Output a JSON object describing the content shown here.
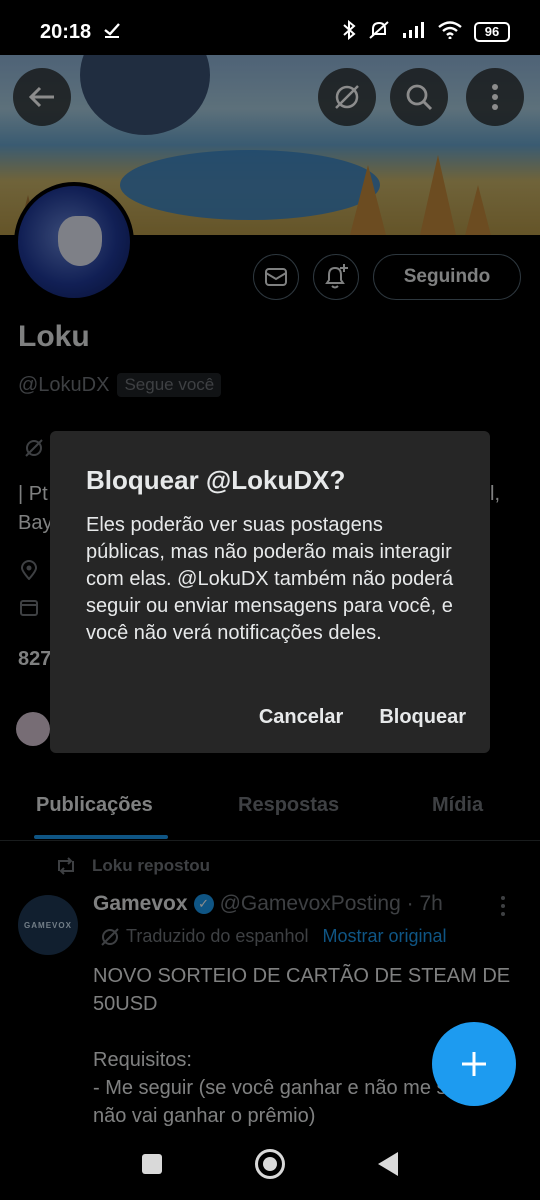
{
  "status_bar": {
    "time": "20:18",
    "battery": "96",
    "icons": [
      "check-icon",
      "bluetooth-icon",
      "mute-icon",
      "signal-icon",
      "wifi-icon",
      "battery-icon"
    ]
  },
  "profile": {
    "name": "Loku",
    "handle": "@LokuDX",
    "follows_you_badge": "Segue você",
    "following_button": "Seguindo",
    "bio_partial_1": "| Pt",
    "bio_partial_1_end": "l,",
    "bio_partial_2": "Bay",
    "count_partial": "827"
  },
  "tabs": [
    "Publicações",
    "Respostas",
    "Mídia"
  ],
  "post": {
    "repost_label": "Loku repostou",
    "avatar_text": "GAMEVOX",
    "author": "Gamevox",
    "handle_time": "@GamevoxPosting · 7h",
    "translated_label": "Traduzido do espanhol",
    "show_original": "Mostrar original",
    "text": "NOVO SORTEIO DE CARTÃO DE STEAM DE 50USD\n\nRequisitos:\n- Me seguir (se você ganhar e não me seguir, não vai ganhar o prêmio)"
  },
  "dialog": {
    "title": "Bloquear @LokuDX?",
    "body": "Eles poderão ver suas postagens públicas, mas não poderão mais interagir com elas. @LokuDX também não poderá seguir ou enviar mensagens para você, e você não verá notificações deles.",
    "cancel": "Cancelar",
    "confirm": "Bloquear"
  },
  "colors": {
    "accent": "#1d9bf0",
    "background": "#000000",
    "dialog": "#262626",
    "muted": "#71767b"
  }
}
